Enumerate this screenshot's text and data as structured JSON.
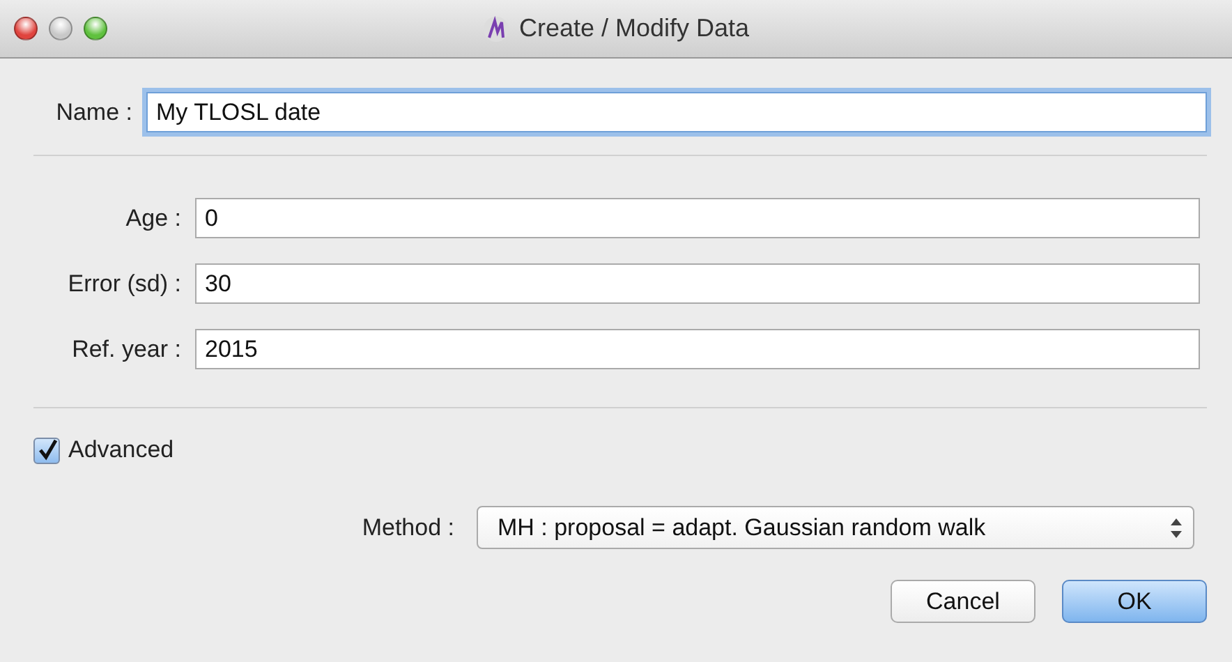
{
  "window": {
    "title": "Create / Modify Data"
  },
  "name_field": {
    "label": "Name :",
    "value": "My TLOSL date",
    "focused": true
  },
  "fields": [
    {
      "label": "Age :",
      "value": "0"
    },
    {
      "label": "Error (sd) :",
      "value": "30"
    },
    {
      "label": "Ref. year :",
      "value": "2015"
    }
  ],
  "advanced": {
    "label": "Advanced",
    "checked": true
  },
  "method": {
    "label": "Method :",
    "value": "MH : proposal = adapt. Gaussian random walk"
  },
  "buttons": [
    {
      "label": "Cancel",
      "default": false
    },
    {
      "label": "OK",
      "default": true
    }
  ]
}
